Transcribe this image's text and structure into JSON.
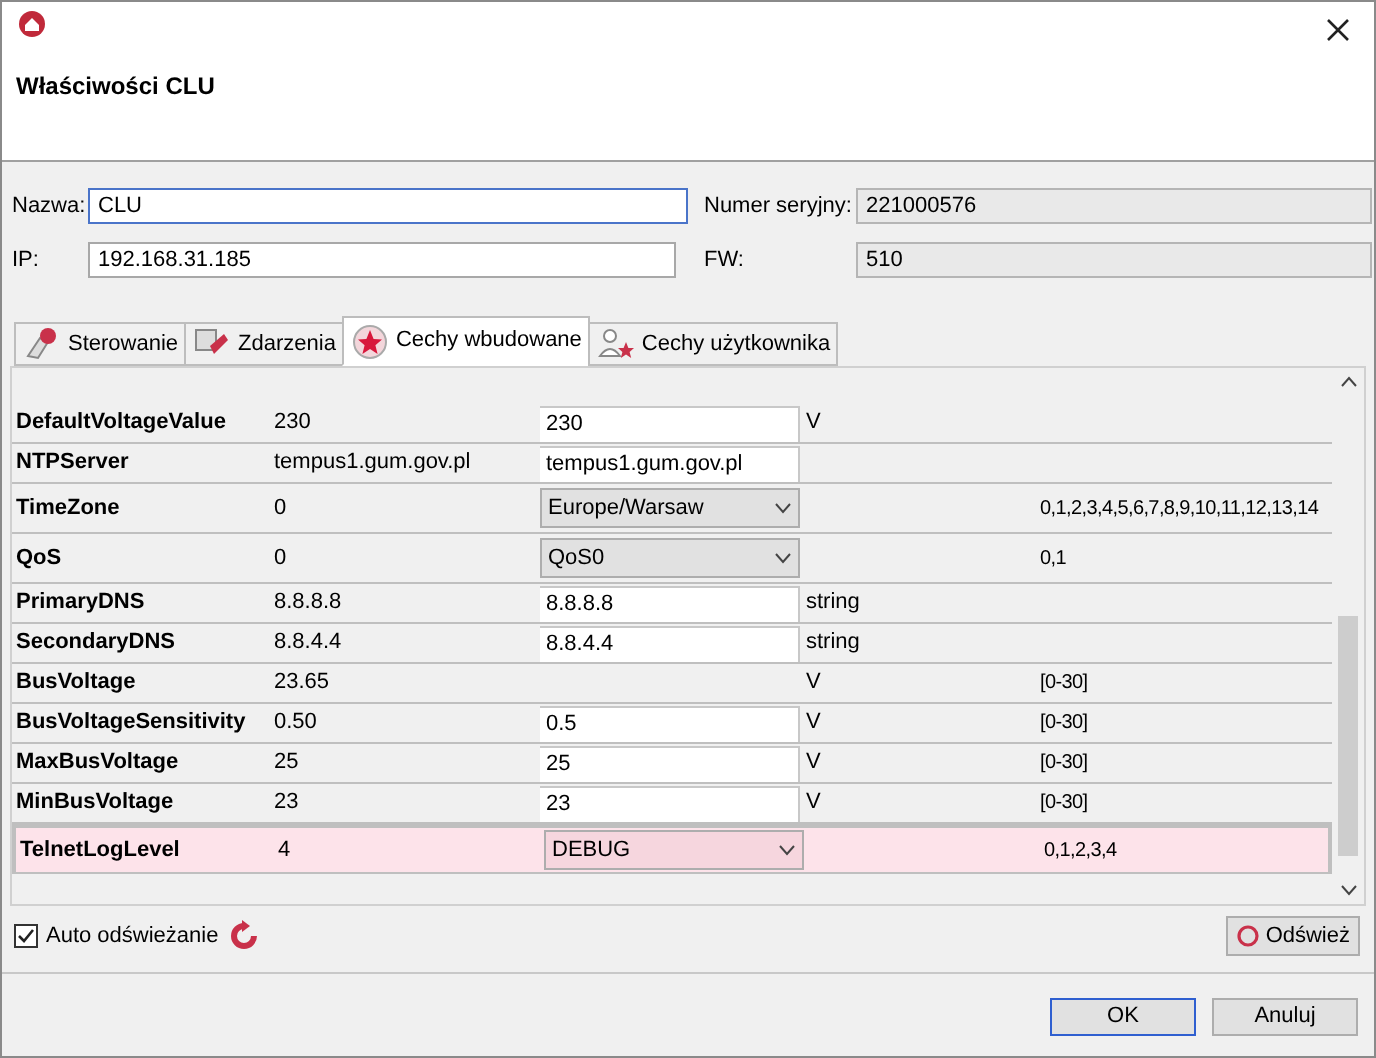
{
  "window": {
    "title": "Właściwości CLU"
  },
  "fields": {
    "name": {
      "label": "Nazwa:",
      "value": "CLU",
      "focused": true
    },
    "ip": {
      "label": "IP:",
      "value": "192.168.31.185"
    },
    "serial": {
      "label": "Numer seryjny:",
      "value": "221000576"
    },
    "fw": {
      "label": "FW:",
      "value": "510"
    }
  },
  "tabs": [
    {
      "label": "Sterowanie",
      "selected": false
    },
    {
      "label": "Zdarzenia",
      "selected": false
    },
    {
      "label": "Cechy wbudowane",
      "selected": true
    },
    {
      "label": "Cechy użytkownika",
      "selected": false
    }
  ],
  "rows": [
    {
      "name": "DefaultVoltageValue",
      "value": "230",
      "editor": {
        "kind": "input",
        "value": "230"
      },
      "unit": "V",
      "highlighted": false
    },
    {
      "name": "NTPServer",
      "value": "tempus1.gum.gov.pl",
      "editor": {
        "kind": "input",
        "value": "tempus1.gum.gov.pl"
      },
      "highlighted": false
    },
    {
      "name": "TimeZone",
      "value": "0",
      "editor": {
        "kind": "select",
        "value": "Europe/Warsaw"
      },
      "range": "0,1,2,3,4,5,6,7,8,9,10,11,12,13,14",
      "highlighted": false
    },
    {
      "name": "QoS",
      "value": "0",
      "editor": {
        "kind": "select",
        "value": "QoS0"
      },
      "range": "0,1",
      "highlighted": false
    },
    {
      "name": "PrimaryDNS",
      "value": "8.8.8.8",
      "editor": {
        "kind": "input",
        "value": "8.8.8.8"
      },
      "unit": "string",
      "highlighted": false
    },
    {
      "name": "SecondaryDNS",
      "value": "8.8.4.4",
      "editor": {
        "kind": "input",
        "value": "8.8.4.4"
      },
      "unit": "string",
      "highlighted": false
    },
    {
      "name": "BusVoltage",
      "value": "23.65",
      "unit": "V",
      "range": "[0-30]",
      "highlighted": false
    },
    {
      "name": "BusVoltageSensitivity",
      "value": "0.50",
      "editor": {
        "kind": "input",
        "value": "0.5"
      },
      "unit": "V",
      "range": "[0-30]",
      "highlighted": false
    },
    {
      "name": "MaxBusVoltage",
      "value": "25",
      "editor": {
        "kind": "input",
        "value": "25"
      },
      "unit": "V",
      "range": "[0-30]",
      "highlighted": false
    },
    {
      "name": "MinBusVoltage",
      "value": "23",
      "editor": {
        "kind": "input",
        "value": "23"
      },
      "unit": "V",
      "range": "[0-30]",
      "highlighted": false
    },
    {
      "name": "TelnetLogLevel",
      "value": "4",
      "editor": {
        "kind": "select",
        "value": "DEBUG"
      },
      "range": "0,1,2,3,4",
      "highlighted": true
    }
  ],
  "auto_refresh": {
    "label": "Auto odświeżanie",
    "checked": true
  },
  "refresh_button": "Odśwież",
  "buttons": [
    {
      "label": "OK",
      "default": true
    },
    {
      "label": "Anuluj",
      "default": false
    }
  ]
}
